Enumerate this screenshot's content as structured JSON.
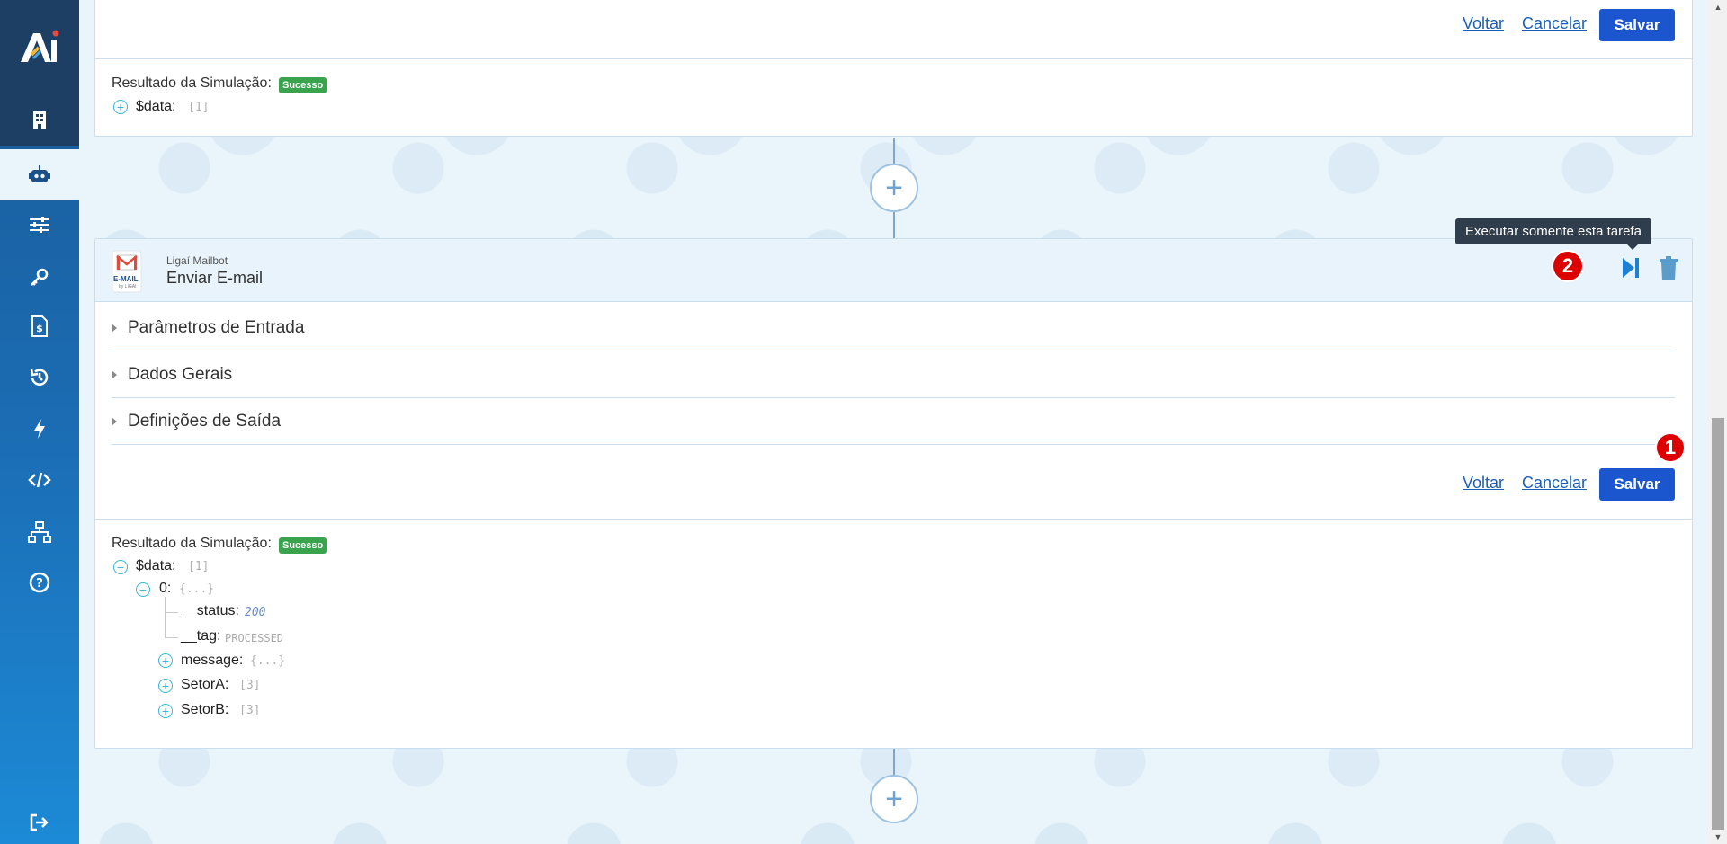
{
  "top_card": {
    "voltar": "Voltar",
    "cancelar": "Cancelar",
    "salvar": "Salvar",
    "sim_label": "Resultado da Simulação:",
    "sim_badge": "Sucesso",
    "data_key": "$data:",
    "data_count": "[1]"
  },
  "task_card": {
    "vendor": "Ligaí Mailbot",
    "title": "Enviar E-mail",
    "logo_text": "E-MAIL",
    "logo_sub": "by LIGAI",
    "tooltip": "Executar somente esta tarefa",
    "marker_2": "2",
    "marker_1": "1",
    "sections": [
      "Parâmetros de Entrada",
      "Dados Gerais",
      "Definições de Saída"
    ],
    "voltar": "Voltar",
    "cancelar": "Cancelar",
    "salvar": "Salvar",
    "sim_label": "Resultado da Simulação:",
    "sim_badge": "Sucesso",
    "tree": {
      "data_key": "$data:",
      "data_count": "[1]",
      "item_key": "0:",
      "item_meta": "{...}",
      "status_key": "__status:",
      "status_val": "200",
      "tag_key": "__tag:",
      "tag_val": "PROCESSED",
      "message_key": "message:",
      "message_meta": "{...}",
      "setor_a_key": "SetorA:",
      "setor_a_count": "[3]",
      "setor_b_key": "SetorB:",
      "setor_b_count": "[3]"
    }
  },
  "colors": {
    "primary": "#1c56cf",
    "success": "#3aa34d",
    "marker": "#dd0000",
    "sidebar": "#1b6cb3"
  }
}
